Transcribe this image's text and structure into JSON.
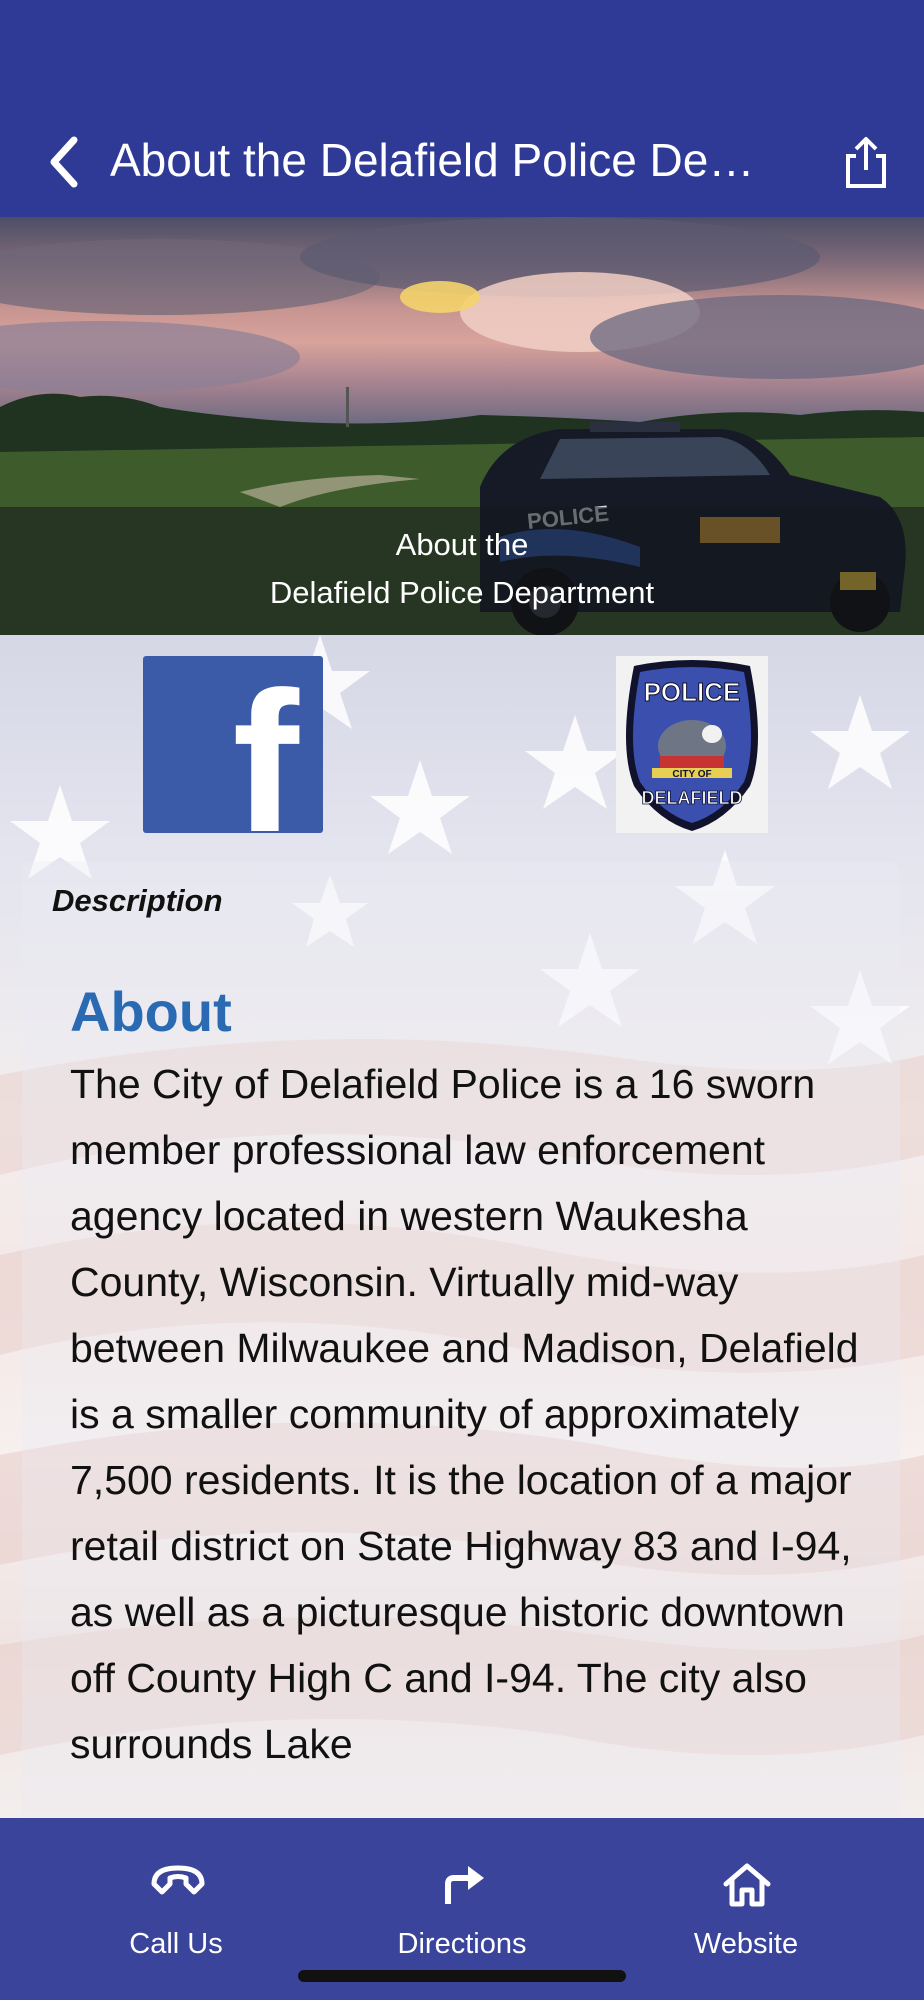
{
  "nav": {
    "title": "About the Delafield Police De…",
    "back_icon": "chevron-left-icon",
    "share_icon": "share-icon"
  },
  "hero": {
    "caption_line1": "About the",
    "caption_line2": "Delafield Police Department",
    "car_door_text": "POLICE"
  },
  "logos": {
    "facebook_letter": "f",
    "badge_top": "POLICE",
    "badge_ribbon": "CITY OF",
    "badge_bottom": "DELAFIELD"
  },
  "description": {
    "label": "Description",
    "heading": "About",
    "body": "The City of Delafield Police is a 16 sworn member professional law enforcement agency located in western Waukesha County, Wisconsin. Virtually mid-way between Milwaukee and Madison, Delafield is a smaller community of approximately 7,500 residents. It is the location of a major retail district on State Highway 83 and I-94, as well as a picturesque historic downtown off County High C and I-94. The city also surrounds Lake"
  },
  "tabs": [
    {
      "label": "Call Us",
      "icon": "phone-icon"
    },
    {
      "label": "Directions",
      "icon": "directions-arrow-icon"
    },
    {
      "label": "Website",
      "icon": "home-icon"
    }
  ],
  "colors": {
    "nav_bar": "#2f3a96",
    "tab_bar": "#3a449a",
    "heading_blue": "#2a6ab2",
    "facebook_blue": "#3b5ba9"
  }
}
